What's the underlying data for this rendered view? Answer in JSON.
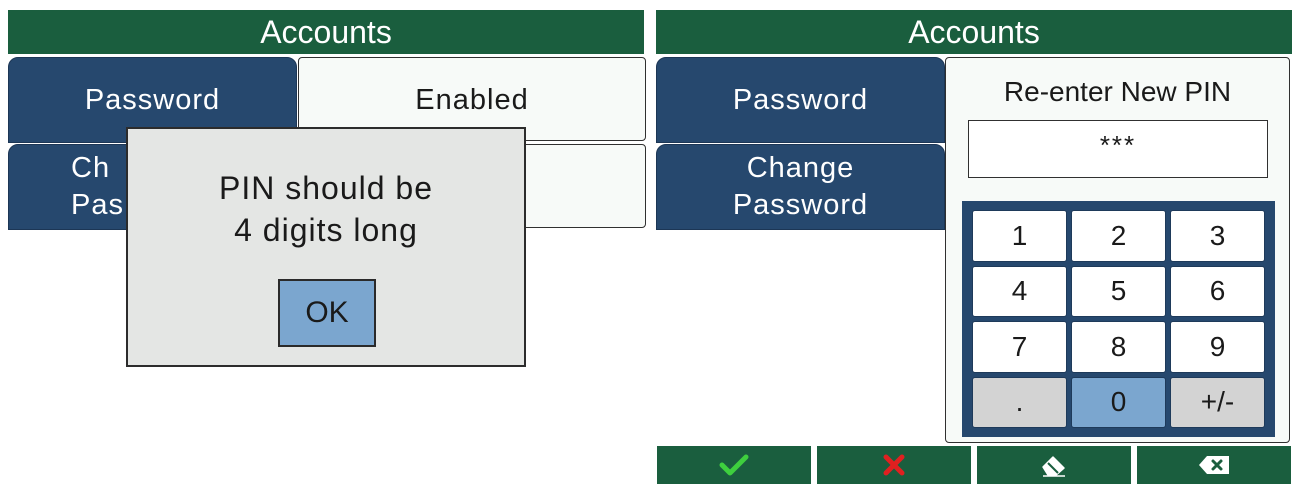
{
  "left": {
    "title": "Accounts",
    "password_label": "Password",
    "password_value": "Enabled",
    "change_password_partial": [
      "Ch",
      "Pas"
    ],
    "dialog": {
      "message_line1": "PIN should be",
      "message_line2": "4 digits long",
      "ok_label": "OK"
    }
  },
  "right": {
    "title": "Accounts",
    "password_label": "Password",
    "change_password_line1": "Change",
    "change_password_line2": "Password",
    "pin_prompt": "Re-enter New PIN",
    "pin_value": "***",
    "keys": [
      "1",
      "2",
      "3",
      "4",
      "5",
      "6",
      "7",
      "8",
      "9",
      ".",
      "0",
      "+/-"
    ],
    "toolbar_icons": [
      "check-icon",
      "cross-icon",
      "eraser-icon",
      "backspace-icon"
    ]
  },
  "colors": {
    "title_bar": "#1a5e3e",
    "nav_button": "#26486e",
    "accent_blue": "#7ba6cf",
    "check_green": "#3ecf3e",
    "cross_red": "#e02020"
  }
}
